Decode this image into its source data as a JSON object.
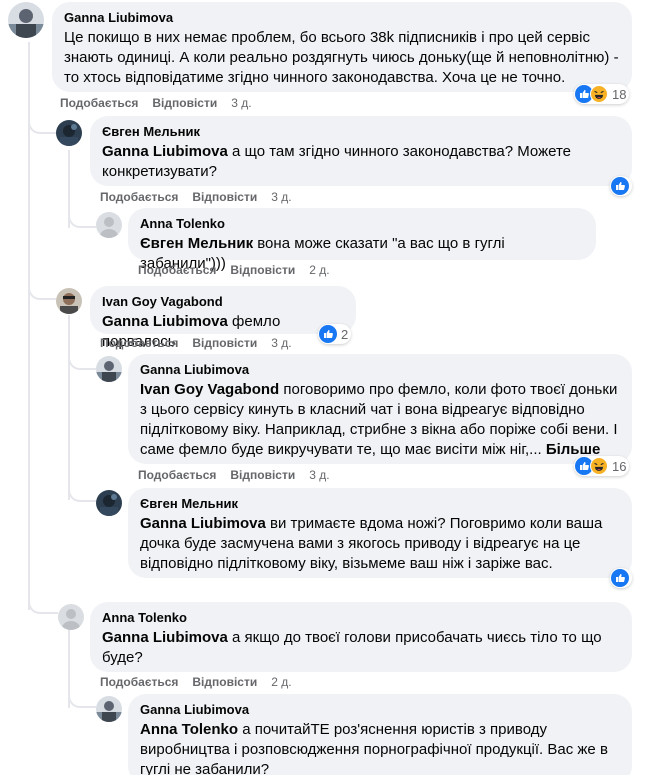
{
  "actions": {
    "like": "Подобається",
    "reply": "Відповісти"
  },
  "colors": {
    "like_blue": "#1877f2",
    "haha_yellow": "#f7b125",
    "bubble_bg": "#f0f2f5",
    "meta_text": "#65676b"
  },
  "comments": [
    {
      "author": "Ganna Liubimova",
      "text": "Це покищо в них немає проблем, бо всього 38k підписників і про цей сервіс знають одиниці. А коли реально роздягнуть чиюсь доньку(ще й неповнолітню) - то хтось відповідатиме згідно чинного законодавства. Хоча це не точно.",
      "time": "3 д.",
      "reactions": {
        "icons": [
          "like-icon",
          "haha-icon"
        ],
        "count": "18"
      }
    },
    {
      "author": "Євген Мельник",
      "mention": "Ganna Liubimova",
      "text": " а що там згідно чинного законодавства? Можете конкретизувати?",
      "time": "3 д.",
      "reactions": {
        "icons": [
          "like-icon"
        ]
      }
    },
    {
      "author": "Anna Tolenko",
      "mention": "Євген Мельник",
      "text": " вона може сказати \"а вас що в гуглі забанили\")))",
      "time": "2 д."
    },
    {
      "author": "Ivan Goy Vagabond",
      "mention": "Ganna Liubimova",
      "text": " фемло порвалось",
      "time": "3 д.",
      "reactions": {
        "icons": [
          "like-icon"
        ],
        "count": "2"
      }
    },
    {
      "author": "Ganna Liubimova",
      "mention": "Ivan Goy Vagabond",
      "text": " поговоримо про фемло, коли фото твоєї доньки з цього сервісу кинуть в класний чат і вона відреагує відповідно підлітковому віку. Наприклад, стрибне з вікна або поріже собі вени. І саме фемло буде викручувати те, що має висіти між ніг,...",
      "more": "Більше",
      "time": "3 д.",
      "reactions": {
        "icons": [
          "like-icon",
          "haha-icon"
        ],
        "count": "16"
      }
    },
    {
      "author": "Євген Мельник",
      "mention": "Ganna Liubimova",
      "text": " ви тримаєте вдома ножі? Поговримо коли ваша дочка буде засмучена вами з якогось приводу і відреагує на це відповідно підлітковому віку, візьмеме ваш ніж і заріже вас.",
      "time": "3 д.",
      "reactions": {
        "icons": [
          "like-icon"
        ]
      }
    },
    {
      "author": "Anna Tolenko",
      "mention": "Ganna Liubimova",
      "text": " а якщо до твоєї голови присобачать чиєсь тіло то що буде?",
      "time": "2 д."
    },
    {
      "author": "Ganna Liubimova",
      "mention": "Anna Tolenko",
      "text": " а почитайТЕ роз'яснення юристів з приводу виробництва і розповсюдження порнографічної продукції. Вас же в гуглі не забанили?"
    }
  ]
}
